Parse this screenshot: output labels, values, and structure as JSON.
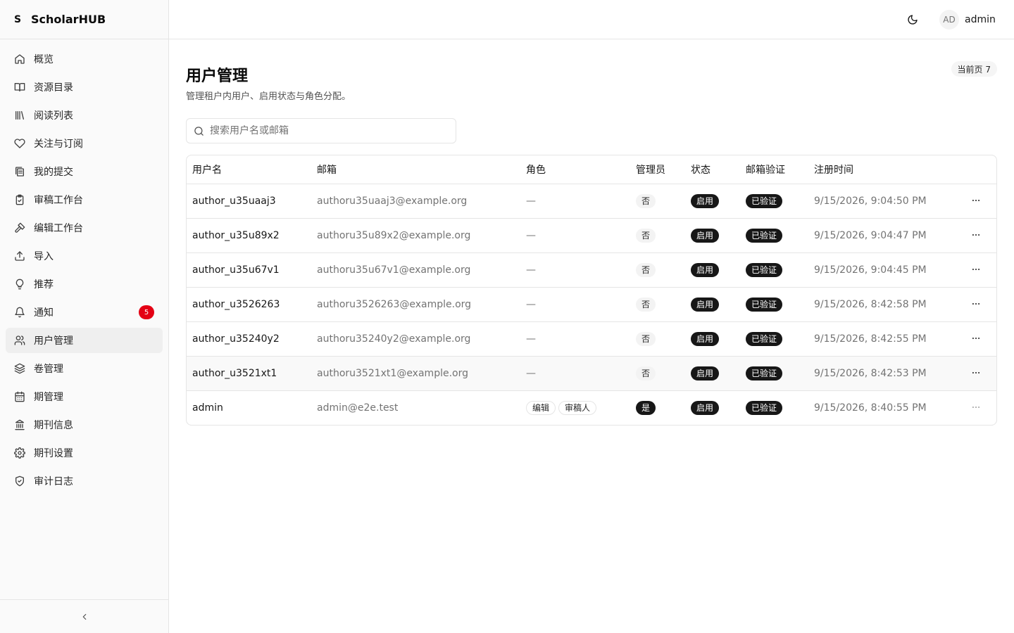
{
  "app": {
    "brand_mark": "S",
    "brand_name": "ScholarHUB"
  },
  "sidebar": {
    "items": [
      {
        "label": "概览",
        "icon": "home-icon",
        "active": false
      },
      {
        "label": "资源目录",
        "icon": "book-open-icon",
        "active": false
      },
      {
        "label": "阅读列表",
        "icon": "library-icon",
        "active": false
      },
      {
        "label": "关注与订阅",
        "icon": "heart-icon",
        "active": false
      },
      {
        "label": "我的提交",
        "icon": "file-stack-icon",
        "active": false
      },
      {
        "label": "审稿工作台",
        "icon": "clipboard-check-icon",
        "active": false
      },
      {
        "label": "编辑工作台",
        "icon": "hammer-icon",
        "active": false
      },
      {
        "label": "导入",
        "icon": "upload-icon",
        "active": false
      },
      {
        "label": "推荐",
        "icon": "lightbulb-icon",
        "active": false
      },
      {
        "label": "通知",
        "icon": "bell-icon",
        "active": false,
        "badge": "5"
      },
      {
        "label": "用户管理",
        "icon": "users-icon",
        "active": true
      },
      {
        "label": "卷管理",
        "icon": "layers-icon",
        "active": false
      },
      {
        "label": "期管理",
        "icon": "calendar-icon",
        "active": false
      },
      {
        "label": "期刊信息",
        "icon": "building-icon",
        "active": false
      },
      {
        "label": "期刊设置",
        "icon": "settings-icon",
        "active": false
      },
      {
        "label": "审计日志",
        "icon": "shield-check-icon",
        "active": false
      }
    ]
  },
  "header": {
    "avatar_initials": "AD",
    "user_name": "admin"
  },
  "page": {
    "title": "用户管理",
    "subtitle": "管理租户内用户、启用状态与角色分配。",
    "page_badge": "当前页 7"
  },
  "search": {
    "placeholder": "搜索用户名或邮箱",
    "value": ""
  },
  "table": {
    "columns": [
      "用户名",
      "邮箱",
      "角色",
      "管理员",
      "状态",
      "邮箱验证",
      "注册时间"
    ],
    "rows": [
      {
        "username": "author_u35uaaj3",
        "email": "authoru35uaaj3@example.org",
        "roles": "—",
        "admin": "否",
        "status": "启用",
        "verified": "已验证",
        "registered": "9/15/2026, 9:04:50 PM"
      },
      {
        "username": "author_u35u89x2",
        "email": "authoru35u89x2@example.org",
        "roles": "—",
        "admin": "否",
        "status": "启用",
        "verified": "已验证",
        "registered": "9/15/2026, 9:04:47 PM"
      },
      {
        "username": "author_u35u67v1",
        "email": "authoru35u67v1@example.org",
        "roles": "—",
        "admin": "否",
        "status": "启用",
        "verified": "已验证",
        "registered": "9/15/2026, 9:04:45 PM"
      },
      {
        "username": "author_u3526263",
        "email": "authoru3526263@example.org",
        "roles": "—",
        "admin": "否",
        "status": "启用",
        "verified": "已验证",
        "registered": "9/15/2026, 8:42:58 PM"
      },
      {
        "username": "author_u35240y2",
        "email": "authoru35240y2@example.org",
        "roles": "—",
        "admin": "否",
        "status": "启用",
        "verified": "已验证",
        "registered": "9/15/2026, 8:42:55 PM"
      },
      {
        "username": "author_u3521xt1",
        "email": "authoru3521xt1@example.org",
        "roles": "—",
        "admin": "否",
        "status": "启用",
        "verified": "已验证",
        "registered": "9/15/2026, 8:42:53 PM"
      },
      {
        "username": "admin",
        "email": "admin@e2e.test",
        "roles": [
          "编辑",
          "审稿人"
        ],
        "admin": "是",
        "status": "启用",
        "verified": "已验证",
        "registered": "9/15/2026, 8:40:55 PM"
      }
    ]
  },
  "colors": {
    "accent": "#171717",
    "notification_badge": "#e40014",
    "muted_text": "#737373",
    "border": "#e5e5e5",
    "sidebar_bg": "#fafafa"
  }
}
